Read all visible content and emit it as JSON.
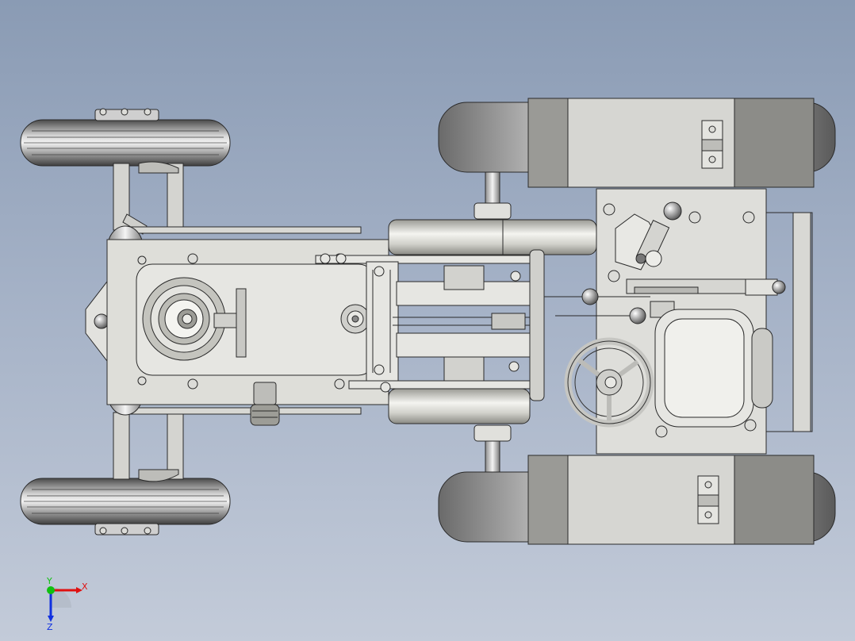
{
  "axes": {
    "x_label": "X",
    "y_label": "Y",
    "z_label": "Z",
    "x_color": "#e01010",
    "y_color": "#10c010",
    "z_color": "#1030e0"
  },
  "scene": {
    "model_fill": "#dcdcd8",
    "model_stroke": "#2a2a2a",
    "tire_fill": "#5a5a5a",
    "fender_dark": "#8a8a88"
  }
}
